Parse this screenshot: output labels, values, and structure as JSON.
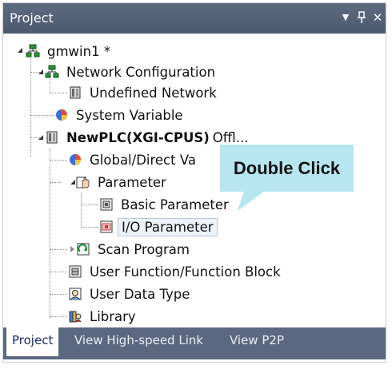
{
  "panel": {
    "title": "Project",
    "buttons": {
      "dropdown": "▼",
      "pin": "ᵖ",
      "close": "✕"
    }
  },
  "tree": {
    "nodes": [
      {
        "label": "gmwin1 *",
        "icon": "project-network-icon"
      },
      {
        "label": "Network Configuration",
        "icon": "network-icon"
      },
      {
        "label": "Undefined Network",
        "icon": "plc-module-icon"
      },
      {
        "label": "System Variable",
        "icon": "system-variable-icon"
      },
      {
        "label": "NewPLC(XGI-CPUS)",
        "suffix": "Offl...",
        "icon": "plc-module-icon"
      },
      {
        "label": "Global/Direct Va",
        "icon": "global-variable-icon"
      },
      {
        "label": "Parameter",
        "icon": "hand-parameter-icon"
      },
      {
        "label": "Basic Parameter",
        "icon": "basic-parameter-icon"
      },
      {
        "label": "I/O Parameter",
        "icon": "io-parameter-icon"
      },
      {
        "label": "Scan Program",
        "icon": "scan-program-icon"
      },
      {
        "label": "User Function/Function Block",
        "icon": "function-block-icon"
      },
      {
        "label": "User Data Type",
        "icon": "user-data-type-icon"
      },
      {
        "label": "Library",
        "icon": "library-icon"
      }
    ]
  },
  "callout": {
    "text": "Double Click"
  },
  "tabs": [
    {
      "label": "Project"
    },
    {
      "label": "View High-speed Link"
    },
    {
      "label": "View P2P"
    }
  ],
  "colors": {
    "titlebar": "#4f5d74",
    "callout": "#b7e6f0",
    "active_tab_text": "#1a2a6c"
  }
}
